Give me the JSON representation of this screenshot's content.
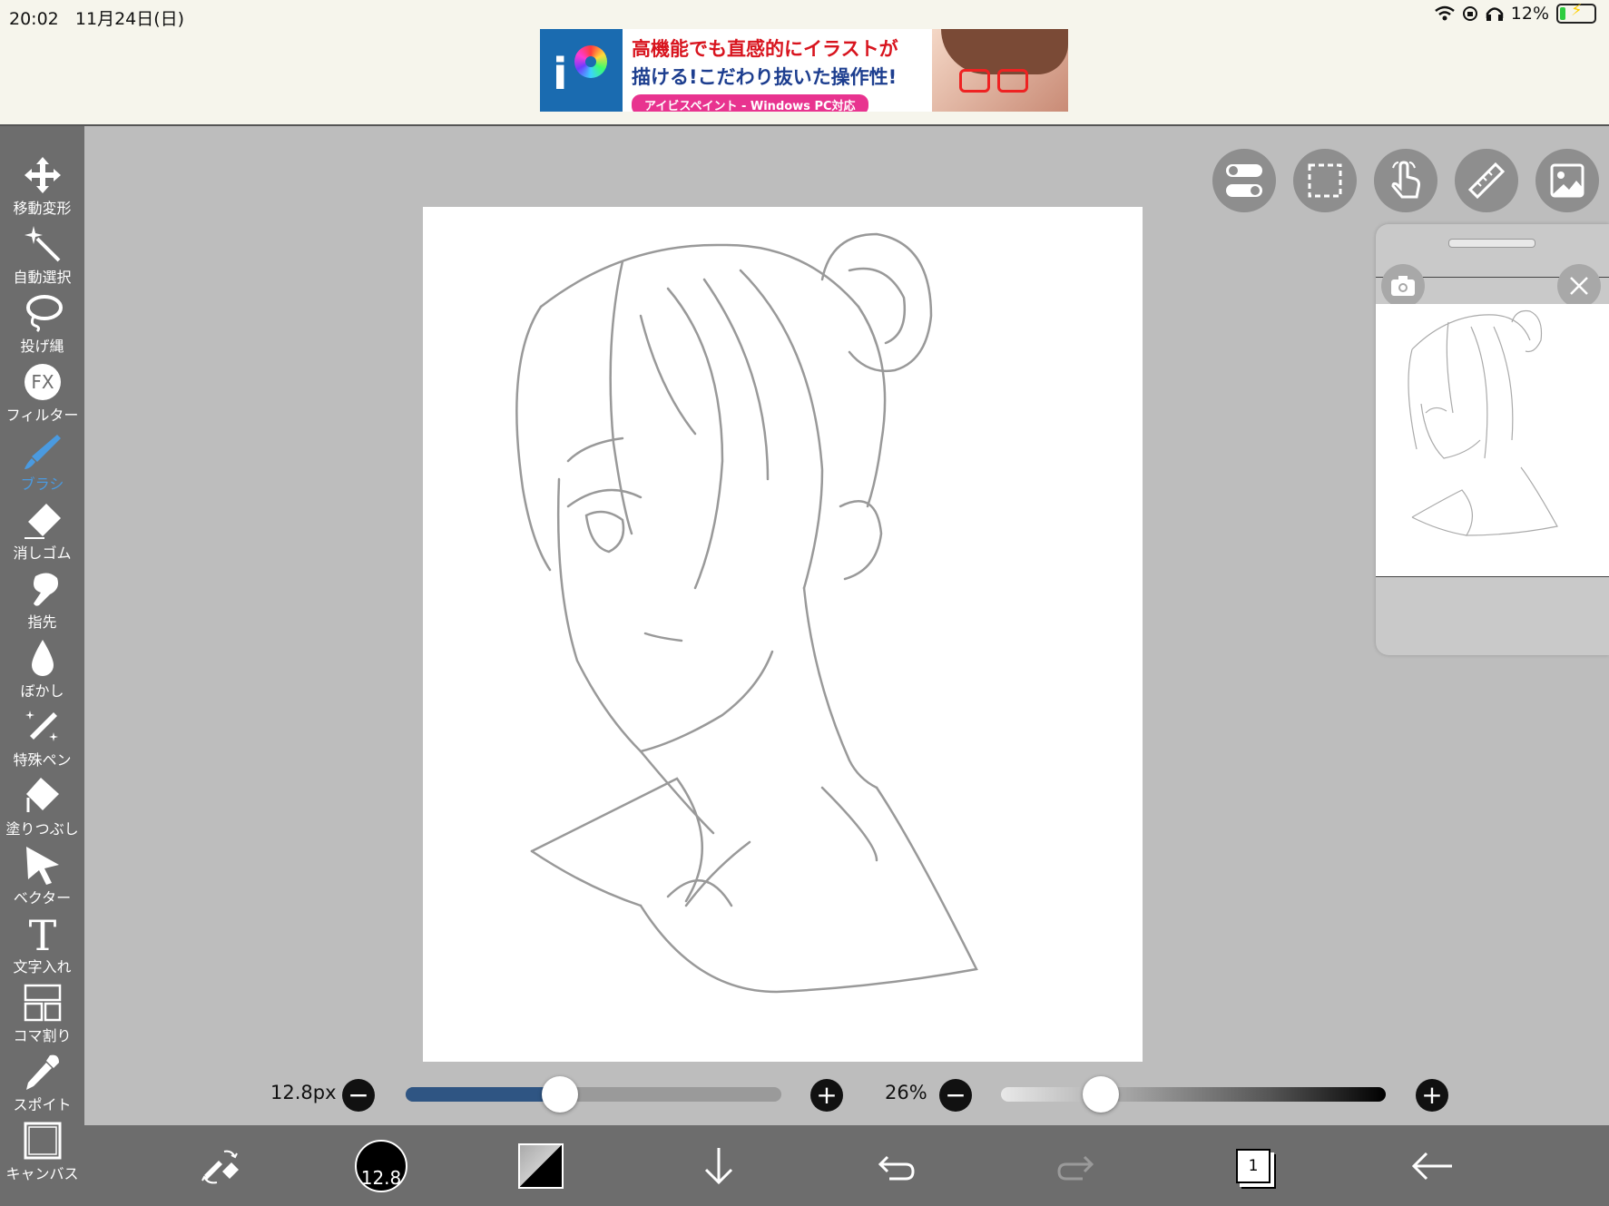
{
  "status_bar": {
    "time": "20:02",
    "date": "11月24日(日)",
    "battery": "12%"
  },
  "ad": {
    "line1": "高機能でも直感的にイラストが",
    "line2": "描ける!こだわり抜いた操作性!",
    "line3": "アイビスペイント - Windows PC対応"
  },
  "tools": [
    {
      "label": "移動変形",
      "icon": "move-transform-icon"
    },
    {
      "label": "自動選択",
      "icon": "magic-wand-icon"
    },
    {
      "label": "投げ縄",
      "icon": "lasso-icon"
    },
    {
      "label": "フィルター",
      "icon": "fx-filter-icon"
    },
    {
      "label": "ブラシ",
      "icon": "brush-icon",
      "active": true
    },
    {
      "label": "消しゴム",
      "icon": "eraser-icon"
    },
    {
      "label": "指先",
      "icon": "finger-smudge-icon"
    },
    {
      "label": "ぼかし",
      "icon": "blur-drop-icon"
    },
    {
      "label": "特殊ペン",
      "icon": "special-pen-icon"
    },
    {
      "label": "塗りつぶし",
      "icon": "fill-bucket-icon"
    },
    {
      "label": "ベクター",
      "icon": "vector-cursor-icon"
    },
    {
      "label": "文字入れ",
      "icon": "text-icon"
    },
    {
      "label": "コマ割り",
      "icon": "frame-divider-icon"
    },
    {
      "label": "スポイト",
      "icon": "eyedropper-icon"
    },
    {
      "label": "キャンバス",
      "icon": "canvas-icon"
    }
  ],
  "brush": {
    "size_label": "12.8px",
    "size_circle": "12.8",
    "size_fraction": 0.41,
    "opacity_label": "26%",
    "opacity_fraction": 0.26
  },
  "layers": {
    "count": "1"
  },
  "colors": {
    "toolbar": "#6d6d6d",
    "accent": "#4a9ae0",
    "slider_fill": "#2f5583"
  }
}
